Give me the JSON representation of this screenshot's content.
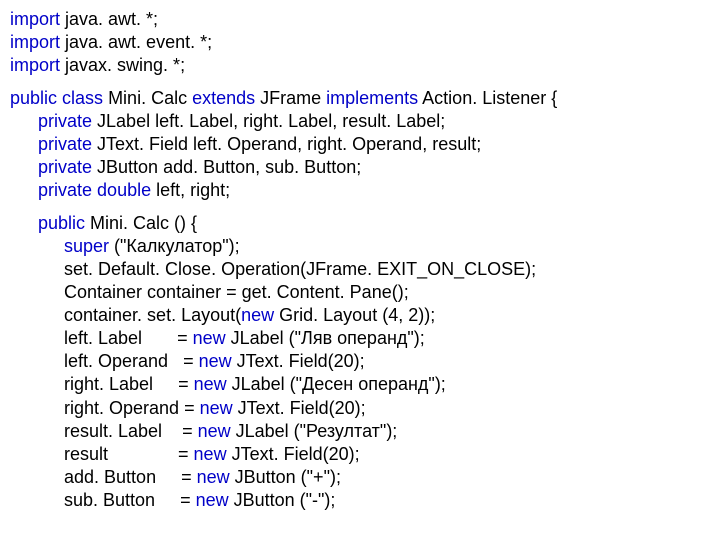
{
  "imports": [
    {
      "kw": "import",
      "rest": " java. awt. *;"
    },
    {
      "kw": "import",
      "rest": " java. awt. event. *;"
    },
    {
      "kw": "import",
      "rest": " javax. swing. *;"
    }
  ],
  "classDecl": {
    "kw1": "public",
    "s1": " ",
    "kw2": "class",
    "s2": " Mini. Calc ",
    "kw3": "extends",
    "s3": " JFrame ",
    "kw4": "implements",
    "s4": " Action. Listener {"
  },
  "fields": [
    {
      "kw": "private",
      "rest": " JLabel left. Label, right. Label, result. Label;"
    },
    {
      "kw": "private",
      "rest": " JText. Field left. Operand, right. Operand, result;"
    },
    {
      "kw": "private",
      "rest": " JButton add. Button, sub. Button;"
    },
    {
      "kw": "private",
      "rest": " ",
      "kw2": "double",
      "rest2": " left, right;"
    }
  ],
  "ctorHead": {
    "kw": "public",
    "rest": " Mini. Calc () {"
  },
  "ctorBody": [
    {
      "pre": "",
      "kw": "super",
      "post": " (\"Калкулатор\");"
    },
    {
      "pre": "set. Default. Close. Operation(JFrame. EXIT_ON_CLOSE);",
      "kw": "",
      "post": ""
    },
    {
      "pre": "Container container = get. Content. Pane();",
      "kw": "",
      "post": ""
    },
    {
      "pre": "container. set. Layout(",
      "kw": "new",
      "post": " Grid. Layout (4, 2));"
    },
    {
      "pre": "left. Label       = ",
      "kw": "new",
      "post": " JLabel (\"Ляв операнд\");"
    },
    {
      "pre": "left. Operand   = ",
      "kw": "new",
      "post": " JText. Field(20);"
    },
    {
      "pre": "right. Label     = ",
      "kw": "new",
      "post": " JLabel (\"Десен операнд\");"
    },
    {
      "pre": "right. Operand = ",
      "kw": "new",
      "post": " JText. Field(20);"
    },
    {
      "pre": "result. Label    = ",
      "kw": "new",
      "post": " JLabel (\"Резултат\");"
    },
    {
      "pre": "result              = ",
      "kw": "new",
      "post": " JText. Field(20);"
    },
    {
      "pre": "add. Button     = ",
      "kw": "new",
      "post": " JButton (\"+\");"
    },
    {
      "pre": "sub. Button     = ",
      "kw": "new",
      "post": " JButton (\"-\");"
    }
  ]
}
